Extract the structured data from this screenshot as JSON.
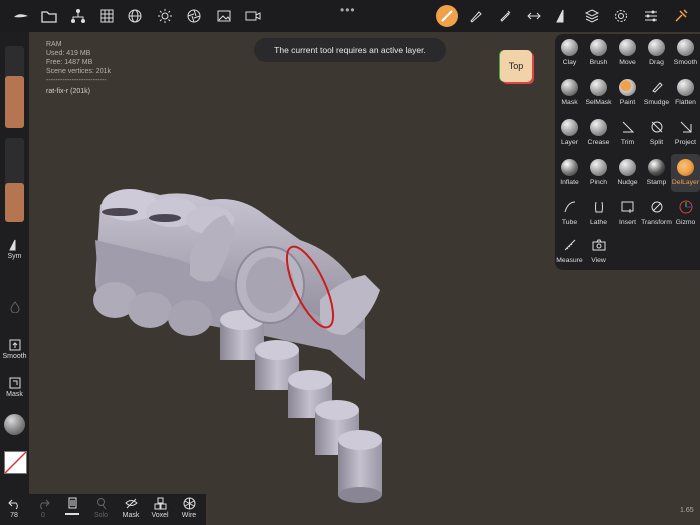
{
  "topbar": {
    "icons": [
      "logo-icon",
      "folder-icon",
      "scene-graph-icon",
      "grid-icon",
      "globe-icon",
      "sun-icon",
      "camera-lens-icon",
      "image-icon",
      "video-icon",
      "dellayer-active-icon",
      "brush-icon",
      "paint-tool-icon",
      "scale-icon",
      "symmetry-icon",
      "layers-icon",
      "gear-icon",
      "sliders-icon",
      "wrench-icon"
    ],
    "dots": "•••"
  },
  "stats": {
    "ram": "RAM",
    "used": "Used: 419 MB",
    "free": "Free: 1487 MB",
    "vertices": "Scene vertices: 201k",
    "separator": "--------------------------",
    "model": "rat-fix-r (201k)"
  },
  "toast": "The current tool requires an active layer.",
  "view_cube": "Top",
  "left_panel": {
    "sym": "Sym",
    "smooth": "Smooth",
    "mask": "Mask",
    "radius_fill": 0.63,
    "intensity_fill": 0.47
  },
  "bottom_bar": {
    "undo_count": "78",
    "redo_count": "0",
    "solo": "Solo",
    "mask": "Mask",
    "voxel": "Voxel",
    "wire": "Wire"
  },
  "version": "1.65",
  "tools": [
    {
      "label": "Clay",
      "icon": "clay-icon"
    },
    {
      "label": "Brush",
      "icon": "brush-icon"
    },
    {
      "label": "Move",
      "icon": "move-icon"
    },
    {
      "label": "Drag",
      "icon": "drag-icon"
    },
    {
      "label": "Smooth",
      "icon": "smooth-icon"
    },
    {
      "label": "Mask",
      "icon": "mask-icon"
    },
    {
      "label": "SelMask",
      "icon": "selmask-icon"
    },
    {
      "label": "Paint",
      "icon": "paint-icon"
    },
    {
      "label": "Smudge",
      "icon": "smudge-icon"
    },
    {
      "label": "Flatten",
      "icon": "flatten-icon"
    },
    {
      "label": "Layer",
      "icon": "layer-icon"
    },
    {
      "label": "Crease",
      "icon": "crease-icon"
    },
    {
      "label": "Trim",
      "icon": "trim-icon"
    },
    {
      "label": "Split",
      "icon": "split-icon"
    },
    {
      "label": "Project",
      "icon": "project-icon"
    },
    {
      "label": "Inflate",
      "icon": "inflate-icon"
    },
    {
      "label": "Pinch",
      "icon": "pinch-icon"
    },
    {
      "label": "Nudge",
      "icon": "nudge-icon"
    },
    {
      "label": "Stamp",
      "icon": "stamp-icon"
    },
    {
      "label": "DelLayer",
      "icon": "dellayer-icon"
    },
    {
      "label": "Tube",
      "icon": "tube-icon"
    },
    {
      "label": "Lathe",
      "icon": "lathe-icon"
    },
    {
      "label": "Insert",
      "icon": "insert-icon"
    },
    {
      "label": "Transform",
      "icon": "transform-icon"
    },
    {
      "label": "Gizmo",
      "icon": "gizmo-icon"
    },
    {
      "label": "Measure",
      "icon": "measure-icon"
    },
    {
      "label": "View",
      "icon": "view-camera-icon"
    }
  ],
  "colors": {
    "background": "#3d3731",
    "panel": "#1e1e20",
    "accent": "#f0a14a",
    "slider_fill": "#b57551",
    "annotation": "#c81e1e"
  }
}
